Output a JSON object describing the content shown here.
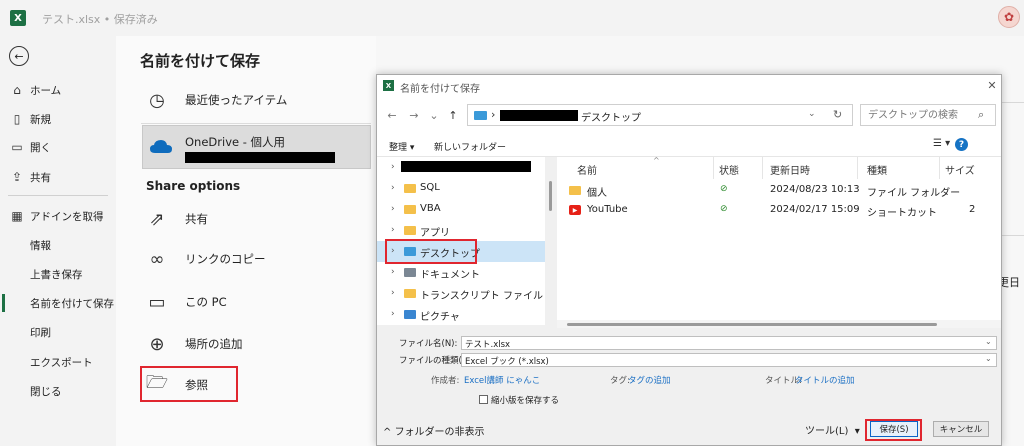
{
  "titlebar": {
    "doc_title": "テスト.xlsx • 保存済み",
    "logo_letter": "X"
  },
  "nav": {
    "items": [
      {
        "label": "ホーム",
        "icon": "home-icon"
      },
      {
        "label": "新規",
        "icon": "new-doc-icon"
      },
      {
        "label": "開く",
        "icon": "open-folder-icon"
      },
      {
        "label": "共有",
        "icon": "share-icon"
      },
      {
        "label": "アドインを取得",
        "icon": "addin-icon"
      },
      {
        "label": "情報"
      },
      {
        "label": "上書き保存"
      },
      {
        "label": "名前を付けて保存",
        "active": true
      },
      {
        "label": "印刷"
      },
      {
        "label": "エクスポート"
      },
      {
        "label": "閉じる"
      }
    ]
  },
  "saveas": {
    "title": "名前を付けて保存",
    "recent_label": "最近使ったアイテム",
    "onedrive_label": "OneDrive - 個人用",
    "share_options_heading": "Share options",
    "share_label": "共有",
    "copy_link_label": "リンクのコピー",
    "this_pc_label": "この PC",
    "add_place_label": "場所の追加",
    "browse_label": "参照"
  },
  "background_peek": {
    "text": "更日"
  },
  "dialog": {
    "title": "名前を付けて保存",
    "address": {
      "current": "デスクトップ"
    },
    "search": {
      "placeholder": "デスクトップの検索"
    },
    "commands": {
      "organize": "整理 ▾",
      "new_folder": "新しいフォルダー",
      "view": "☰ ▾"
    },
    "tree": [
      {
        "label": "SQL"
      },
      {
        "label": "VBA"
      },
      {
        "label": "アプリ"
      },
      {
        "label": "デスクトップ",
        "selected": true
      },
      {
        "label": "ドキュメント"
      },
      {
        "label": "トランスクリプト ファイル"
      },
      {
        "label": "ピクチャ"
      }
    ],
    "columns": {
      "name": "名前",
      "status": "状態",
      "modified": "更新日時",
      "type": "種類",
      "size": "サイズ"
    },
    "files": [
      {
        "name": "個人",
        "status": "⊘",
        "modified": "2024/08/23 10:13",
        "type": "ファイル フォルダー",
        "size": ""
      },
      {
        "name": "YouTube",
        "status": "⊘",
        "modified": "2024/02/17 15:09",
        "type": "ショートカット",
        "size": "2"
      }
    ],
    "form": {
      "filename_label": "ファイル名(N):",
      "filename_value": "テスト.xlsx",
      "filetype_label": "ファイルの種類(T):",
      "filetype_value": "Excel ブック (*.xlsx)",
      "author_label": "作成者:",
      "author_value": "Excel講師 にゃんこ",
      "tags_label": "タグ:",
      "tags_value": "タグの追加",
      "title_label": "タイトル:",
      "title_value": "タイトルの追加",
      "thumbnail_label": "縮小版を保存する"
    },
    "footer": {
      "hide_folders": "フォルダーの非表示",
      "tools": "ツール(L)",
      "save": "保存(S)",
      "cancel": "キャンセル"
    }
  }
}
